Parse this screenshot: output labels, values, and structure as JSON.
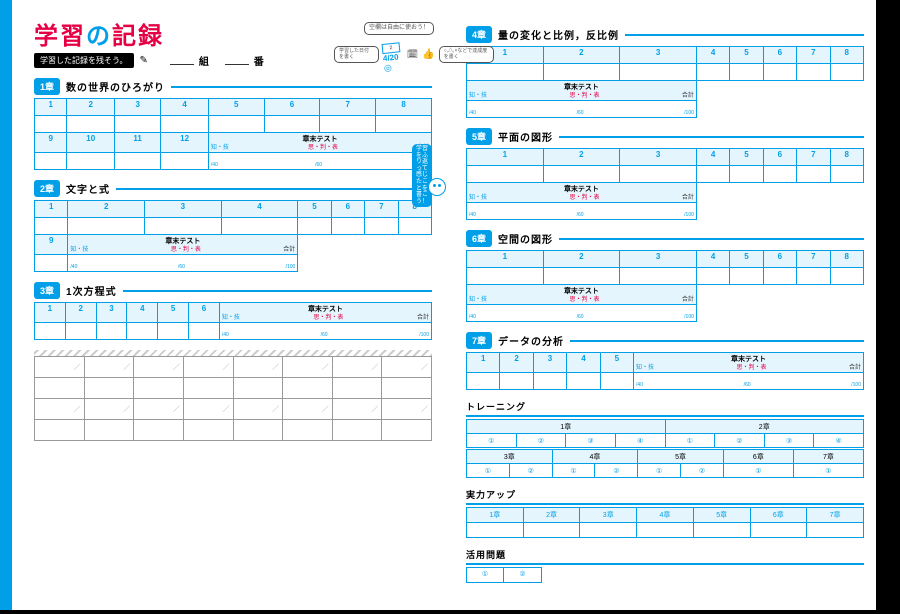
{
  "title": {
    "part1": "学習",
    "part2": "の",
    "part3": "記録"
  },
  "subtitle_badge": "学習した記録を残そう。",
  "class_label_1": "組",
  "class_label_2": "番",
  "callouts": {
    "top": "空欄は自由に使おう！",
    "date_example": "4/20",
    "left_note": "学習した日付を書く",
    "right_note": "○,△,×などで達成度を書く",
    "reflect": "学習をふり返って感じたことを書こう！"
  },
  "chapters": [
    {
      "num": "1章",
      "title": "数の世界のひろがり",
      "lessons": [
        1,
        2,
        3,
        4,
        5,
        6,
        7,
        8,
        9,
        10,
        11,
        12
      ],
      "test_col_span": 4
    },
    {
      "num": "2章",
      "title": "文字と式",
      "lessons": [
        1,
        2,
        3,
        4,
        5,
        6,
        7,
        8,
        9
      ],
      "test_col_span": 3
    },
    {
      "num": "3章",
      "title": "1次方程式",
      "lessons": [
        1,
        2,
        3,
        4,
        5,
        6
      ],
      "test_col_span": 3
    },
    {
      "num": "4章",
      "title": "量の変化と比例，反比例",
      "lessons": [
        1,
        2,
        3,
        4,
        5,
        6,
        7,
        8
      ],
      "test_col_span": 3
    },
    {
      "num": "5章",
      "title": "平面の図形",
      "lessons": [
        1,
        2,
        3,
        4,
        5,
        6,
        7,
        8
      ],
      "test_col_span": 3
    },
    {
      "num": "6章",
      "title": "空間の図形",
      "lessons": [
        1,
        2,
        3,
        4,
        5,
        6,
        7,
        8
      ],
      "test_col_span": 3
    },
    {
      "num": "7章",
      "title": "データの分析",
      "lessons": [
        1,
        2,
        3,
        4,
        5
      ],
      "test_col_span": 3
    }
  ],
  "test": {
    "label": "章末テスト",
    "cols": [
      "知・技",
      "思・判・表",
      "合計"
    ],
    "max": [
      "/40",
      "/60",
      "/100"
    ]
  },
  "training": {
    "heading": "トレーニング",
    "row1_heads": [
      "1章",
      "2章"
    ],
    "row1_cells": [
      "①",
      "②",
      "③",
      "④",
      "①",
      "②",
      "③",
      "④"
    ],
    "row2_heads": [
      "3章",
      "4章",
      "5章",
      "6章",
      "7章"
    ],
    "row2_cells": [
      "①",
      "②",
      "①",
      "②",
      "①",
      "②",
      "①",
      "①"
    ]
  },
  "jitsuryoku": {
    "heading": "実力アップ",
    "cols": [
      "1章",
      "2章",
      "3章",
      "4章",
      "5章",
      "6章",
      "7章"
    ]
  },
  "katsuyo": {
    "heading": "活用問題",
    "cells": [
      "①",
      "②"
    ]
  },
  "slash": "／"
}
